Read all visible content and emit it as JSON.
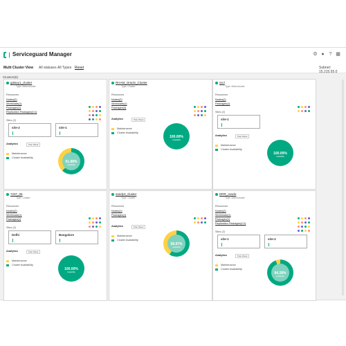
{
  "app": {
    "title": "Serviceguard Manager"
  },
  "subbar": {
    "view": "Multi Cluster View",
    "filter1": "All statuses",
    "filter2": "All Types",
    "reset": "Reset",
    "subnet": "Subnet: 15.215.55.0"
  },
  "clusters_label": "Clusters(6)",
  "labels": {
    "resources": "Resources",
    "sites": "Sites (2)",
    "analytics": "Analytics",
    "past": "Past Week",
    "maintenance": "Maintenance",
    "availability": "Cluster Availability",
    "avail_word": "Availability"
  },
  "colors": {
    "green": "#01a982",
    "yellow": "#ffd144",
    "light_green": "#7fd3be"
  },
  "cards": [
    {
      "name": "galaxy1_cluster",
      "type": "Type: Metrocluster",
      "resources": [
        "Nodes(2)",
        "Workloads(1)",
        "Packages(1)",
        "Replication Packages(1/1)"
      ],
      "sites": [
        "site-2",
        "site-1"
      ],
      "pct": "61.88%"
    },
    {
      "name": "RHAM_Oracle_Cluster",
      "type": "Type: Cluster",
      "resources": [
        "Nodes(2)",
        "Workloads(1)",
        "Packages(4)"
      ],
      "sites": [],
      "pct": "100.00%"
    },
    {
      "name": "sscl",
      "type": "Type: Metrocluster",
      "resources": [
        "Nodes(2)",
        "Packages(1)"
      ],
      "sites": [
        "site-1"
      ],
      "pct": "100.00%"
    },
    {
      "name": "7237_05",
      "type": "Type: Cluster",
      "resources": [
        "Nodes(2)",
        "Workloads(1)",
        "Packages(1)"
      ],
      "sites": [
        "Delhi",
        "Bangalore"
      ],
      "pct": "100.00%"
    },
    {
      "name": "sandy3_cluster",
      "type": "Type: Cluster",
      "resources": [
        "Nodes(1)",
        "Packages(1)"
      ],
      "sites": [],
      "pct": "58.97%"
    },
    {
      "name": "DRR_oracle",
      "type": "Type: Metrocluster",
      "resources": [
        "Nodes(2)",
        "Workloads(1)",
        "Packages(1)",
        "Replication Packages(1/1)"
      ],
      "sites": [
        "site-1",
        "site-2"
      ],
      "pct": "94.28%"
    }
  ]
}
